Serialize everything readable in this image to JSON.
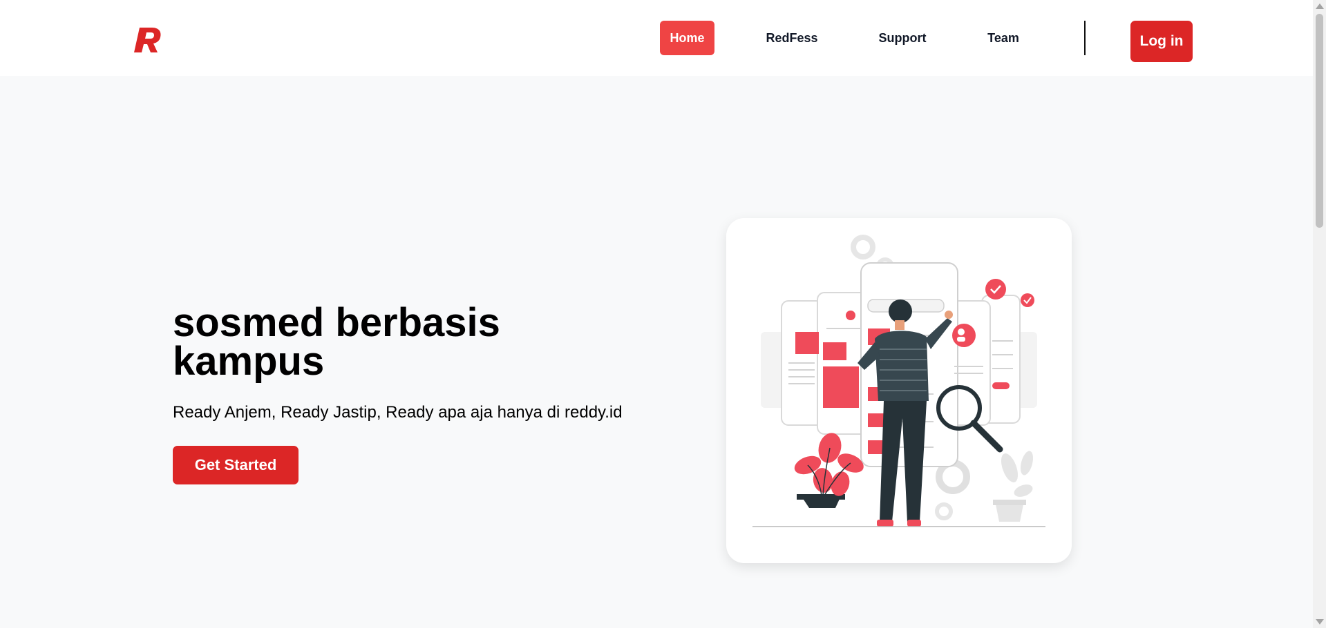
{
  "navbar": {
    "logo": "R",
    "links": [
      {
        "label": "Home",
        "active": true
      },
      {
        "label": "RedFess",
        "active": false
      },
      {
        "label": "Support",
        "active": false
      },
      {
        "label": "Team",
        "active": false
      }
    ],
    "login_label": "Log in"
  },
  "hero": {
    "title_line1": "sosmed berbasis",
    "title_line2": "kampus",
    "subtitle": "Ready Anjem, Ready Jastip, Ready apa aja hanya di reddy.id",
    "cta_label": "Get Started"
  },
  "colors": {
    "accent": "#dc2626",
    "accent_light": "#ef4444",
    "background": "#f8f9fa",
    "illustration_dark": "#263238"
  },
  "illustration": {
    "icon": "person-browsing-app-screens-illustration"
  }
}
